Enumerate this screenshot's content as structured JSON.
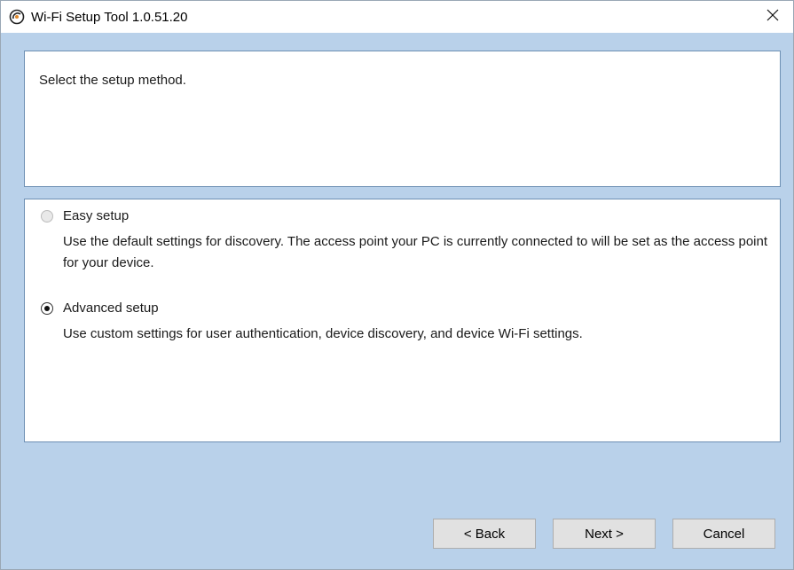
{
  "window": {
    "title": "Wi-Fi Setup Tool 1.0.51.20",
    "background_color": "#b9d1ea",
    "app_icon": "wifi-setup-app-icon",
    "close_icon": "close-icon"
  },
  "header_panel": {
    "instruction": "Select the setup method."
  },
  "options": {
    "easy": {
      "label": "Easy setup",
      "description": "Use the default settings for discovery. The access point your PC is currently connected to will be set as the access point for your device.",
      "selected": false,
      "enabled": false
    },
    "advanced": {
      "label": "Advanced setup",
      "description": "Use custom settings for user authentication, device discovery, and device Wi-Fi settings.",
      "selected": true,
      "enabled": true
    }
  },
  "buttons": {
    "back_label": "< Back",
    "next_label": "Next >",
    "cancel_label": "Cancel"
  }
}
